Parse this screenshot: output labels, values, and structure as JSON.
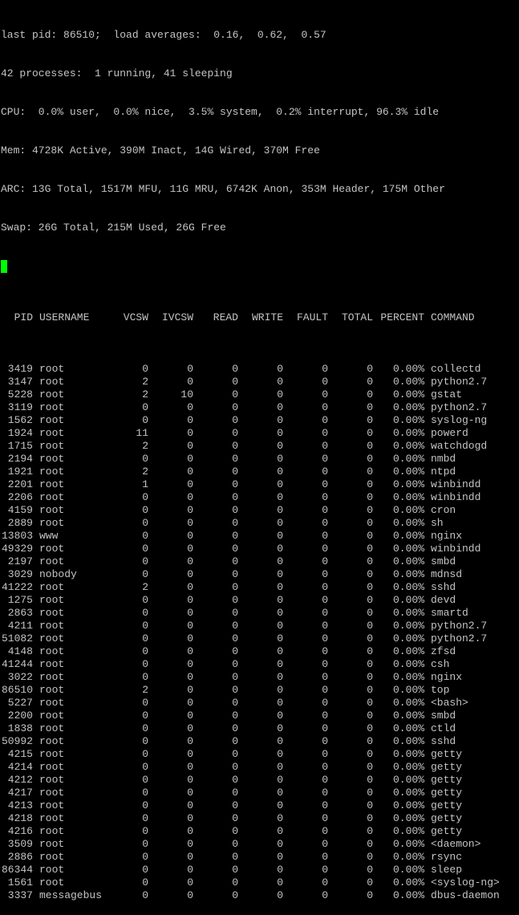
{
  "colors": {
    "background": "#000000",
    "text": "#c4c4c4",
    "cursor": "#00ff00"
  },
  "header": {
    "line1": "last pid: 86510;  load averages:  0.16,  0.62,  0.57",
    "line2": "42 processes:  1 running, 41 sleeping",
    "line3": "CPU:  0.0% user,  0.0% nice,  3.5% system,  0.2% interrupt, 96.3% idle",
    "line4": "Mem: 4728K Active, 390M Inact, 14G Wired, 370M Free",
    "line5": "ARC: 13G Total, 1517M MFU, 11G MRU, 6742K Anon, 353M Header, 175M Other",
    "line6": "Swap: 26G Total, 215M Used, 26G Free"
  },
  "table": {
    "columns": {
      "pid": "PID",
      "username": "USERNAME",
      "vcsw": "VCSW",
      "ivcsw": "IVCSW",
      "read": "READ",
      "write": "WRITE",
      "fault": "FAULT",
      "total": "TOTAL",
      "percent": "PERCENT",
      "command": "COMMAND"
    },
    "rows": [
      {
        "pid": "3419",
        "user": "root",
        "vcsw": "0",
        "ivcsw": "0",
        "read": "0",
        "write": "0",
        "fault": "0",
        "total": "0",
        "percent": "0.00%",
        "command": "collectd"
      },
      {
        "pid": "3147",
        "user": "root",
        "vcsw": "2",
        "ivcsw": "0",
        "read": "0",
        "write": "0",
        "fault": "0",
        "total": "0",
        "percent": "0.00%",
        "command": "python2.7"
      },
      {
        "pid": "5228",
        "user": "root",
        "vcsw": "2",
        "ivcsw": "10",
        "read": "0",
        "write": "0",
        "fault": "0",
        "total": "0",
        "percent": "0.00%",
        "command": "gstat"
      },
      {
        "pid": "3119",
        "user": "root",
        "vcsw": "0",
        "ivcsw": "0",
        "read": "0",
        "write": "0",
        "fault": "0",
        "total": "0",
        "percent": "0.00%",
        "command": "python2.7"
      },
      {
        "pid": "1562",
        "user": "root",
        "vcsw": "0",
        "ivcsw": "0",
        "read": "0",
        "write": "0",
        "fault": "0",
        "total": "0",
        "percent": "0.00%",
        "command": "syslog-ng"
      },
      {
        "pid": "1924",
        "user": "root",
        "vcsw": "11",
        "ivcsw": "0",
        "read": "0",
        "write": "0",
        "fault": "0",
        "total": "0",
        "percent": "0.00%",
        "command": "powerd"
      },
      {
        "pid": "1715",
        "user": "root",
        "vcsw": "2",
        "ivcsw": "0",
        "read": "0",
        "write": "0",
        "fault": "0",
        "total": "0",
        "percent": "0.00%",
        "command": "watchdogd"
      },
      {
        "pid": "2194",
        "user": "root",
        "vcsw": "0",
        "ivcsw": "0",
        "read": "0",
        "write": "0",
        "fault": "0",
        "total": "0",
        "percent": "0.00%",
        "command": "nmbd"
      },
      {
        "pid": "1921",
        "user": "root",
        "vcsw": "2",
        "ivcsw": "0",
        "read": "0",
        "write": "0",
        "fault": "0",
        "total": "0",
        "percent": "0.00%",
        "command": "ntpd"
      },
      {
        "pid": "2201",
        "user": "root",
        "vcsw": "1",
        "ivcsw": "0",
        "read": "0",
        "write": "0",
        "fault": "0",
        "total": "0",
        "percent": "0.00%",
        "command": "winbindd"
      },
      {
        "pid": "2206",
        "user": "root",
        "vcsw": "0",
        "ivcsw": "0",
        "read": "0",
        "write": "0",
        "fault": "0",
        "total": "0",
        "percent": "0.00%",
        "command": "winbindd"
      },
      {
        "pid": "4159",
        "user": "root",
        "vcsw": "0",
        "ivcsw": "0",
        "read": "0",
        "write": "0",
        "fault": "0",
        "total": "0",
        "percent": "0.00%",
        "command": "cron"
      },
      {
        "pid": "2889",
        "user": "root",
        "vcsw": "0",
        "ivcsw": "0",
        "read": "0",
        "write": "0",
        "fault": "0",
        "total": "0",
        "percent": "0.00%",
        "command": "sh"
      },
      {
        "pid": "13803",
        "user": "www",
        "vcsw": "0",
        "ivcsw": "0",
        "read": "0",
        "write": "0",
        "fault": "0",
        "total": "0",
        "percent": "0.00%",
        "command": "nginx"
      },
      {
        "pid": "49329",
        "user": "root",
        "vcsw": "0",
        "ivcsw": "0",
        "read": "0",
        "write": "0",
        "fault": "0",
        "total": "0",
        "percent": "0.00%",
        "command": "winbindd"
      },
      {
        "pid": "2197",
        "user": "root",
        "vcsw": "0",
        "ivcsw": "0",
        "read": "0",
        "write": "0",
        "fault": "0",
        "total": "0",
        "percent": "0.00%",
        "command": "smbd"
      },
      {
        "pid": "3029",
        "user": "nobody",
        "vcsw": "0",
        "ivcsw": "0",
        "read": "0",
        "write": "0",
        "fault": "0",
        "total": "0",
        "percent": "0.00%",
        "command": "mdnsd"
      },
      {
        "pid": "41222",
        "user": "root",
        "vcsw": "2",
        "ivcsw": "0",
        "read": "0",
        "write": "0",
        "fault": "0",
        "total": "0",
        "percent": "0.00%",
        "command": "sshd"
      },
      {
        "pid": "1275",
        "user": "root",
        "vcsw": "0",
        "ivcsw": "0",
        "read": "0",
        "write": "0",
        "fault": "0",
        "total": "0",
        "percent": "0.00%",
        "command": "devd"
      },
      {
        "pid": "2863",
        "user": "root",
        "vcsw": "0",
        "ivcsw": "0",
        "read": "0",
        "write": "0",
        "fault": "0",
        "total": "0",
        "percent": "0.00%",
        "command": "smartd"
      },
      {
        "pid": "4211",
        "user": "root",
        "vcsw": "0",
        "ivcsw": "0",
        "read": "0",
        "write": "0",
        "fault": "0",
        "total": "0",
        "percent": "0.00%",
        "command": "python2.7"
      },
      {
        "pid": "51082",
        "user": "root",
        "vcsw": "0",
        "ivcsw": "0",
        "read": "0",
        "write": "0",
        "fault": "0",
        "total": "0",
        "percent": "0.00%",
        "command": "python2.7"
      },
      {
        "pid": "4148",
        "user": "root",
        "vcsw": "0",
        "ivcsw": "0",
        "read": "0",
        "write": "0",
        "fault": "0",
        "total": "0",
        "percent": "0.00%",
        "command": "zfsd"
      },
      {
        "pid": "41244",
        "user": "root",
        "vcsw": "0",
        "ivcsw": "0",
        "read": "0",
        "write": "0",
        "fault": "0",
        "total": "0",
        "percent": "0.00%",
        "command": "csh"
      },
      {
        "pid": "3022",
        "user": "root",
        "vcsw": "0",
        "ivcsw": "0",
        "read": "0",
        "write": "0",
        "fault": "0",
        "total": "0",
        "percent": "0.00%",
        "command": "nginx"
      },
      {
        "pid": "86510",
        "user": "root",
        "vcsw": "2",
        "ivcsw": "0",
        "read": "0",
        "write": "0",
        "fault": "0",
        "total": "0",
        "percent": "0.00%",
        "command": "top"
      },
      {
        "pid": "5227",
        "user": "root",
        "vcsw": "0",
        "ivcsw": "0",
        "read": "0",
        "write": "0",
        "fault": "0",
        "total": "0",
        "percent": "0.00%",
        "command": "<bash>"
      },
      {
        "pid": "2200",
        "user": "root",
        "vcsw": "0",
        "ivcsw": "0",
        "read": "0",
        "write": "0",
        "fault": "0",
        "total": "0",
        "percent": "0.00%",
        "command": "smbd"
      },
      {
        "pid": "1838",
        "user": "root",
        "vcsw": "0",
        "ivcsw": "0",
        "read": "0",
        "write": "0",
        "fault": "0",
        "total": "0",
        "percent": "0.00%",
        "command": "ctld"
      },
      {
        "pid": "50992",
        "user": "root",
        "vcsw": "0",
        "ivcsw": "0",
        "read": "0",
        "write": "0",
        "fault": "0",
        "total": "0",
        "percent": "0.00%",
        "command": "sshd"
      },
      {
        "pid": "4215",
        "user": "root",
        "vcsw": "0",
        "ivcsw": "0",
        "read": "0",
        "write": "0",
        "fault": "0",
        "total": "0",
        "percent": "0.00%",
        "command": "getty"
      },
      {
        "pid": "4214",
        "user": "root",
        "vcsw": "0",
        "ivcsw": "0",
        "read": "0",
        "write": "0",
        "fault": "0",
        "total": "0",
        "percent": "0.00%",
        "command": "getty"
      },
      {
        "pid": "4212",
        "user": "root",
        "vcsw": "0",
        "ivcsw": "0",
        "read": "0",
        "write": "0",
        "fault": "0",
        "total": "0",
        "percent": "0.00%",
        "command": "getty"
      },
      {
        "pid": "4217",
        "user": "root",
        "vcsw": "0",
        "ivcsw": "0",
        "read": "0",
        "write": "0",
        "fault": "0",
        "total": "0",
        "percent": "0.00%",
        "command": "getty"
      },
      {
        "pid": "4213",
        "user": "root",
        "vcsw": "0",
        "ivcsw": "0",
        "read": "0",
        "write": "0",
        "fault": "0",
        "total": "0",
        "percent": "0.00%",
        "command": "getty"
      },
      {
        "pid": "4218",
        "user": "root",
        "vcsw": "0",
        "ivcsw": "0",
        "read": "0",
        "write": "0",
        "fault": "0",
        "total": "0",
        "percent": "0.00%",
        "command": "getty"
      },
      {
        "pid": "4216",
        "user": "root",
        "vcsw": "0",
        "ivcsw": "0",
        "read": "0",
        "write": "0",
        "fault": "0",
        "total": "0",
        "percent": "0.00%",
        "command": "getty"
      },
      {
        "pid": "3509",
        "user": "root",
        "vcsw": "0",
        "ivcsw": "0",
        "read": "0",
        "write": "0",
        "fault": "0",
        "total": "0",
        "percent": "0.00%",
        "command": "<daemon>"
      },
      {
        "pid": "2886",
        "user": "root",
        "vcsw": "0",
        "ivcsw": "0",
        "read": "0",
        "write": "0",
        "fault": "0",
        "total": "0",
        "percent": "0.00%",
        "command": "rsync"
      },
      {
        "pid": "86344",
        "user": "root",
        "vcsw": "0",
        "ivcsw": "0",
        "read": "0",
        "write": "0",
        "fault": "0",
        "total": "0",
        "percent": "0.00%",
        "command": "sleep"
      },
      {
        "pid": "1561",
        "user": "root",
        "vcsw": "0",
        "ivcsw": "0",
        "read": "0",
        "write": "0",
        "fault": "0",
        "total": "0",
        "percent": "0.00%",
        "command": "<syslog-ng>"
      },
      {
        "pid": "3337",
        "user": "messagebus",
        "vcsw": "0",
        "ivcsw": "0",
        "read": "0",
        "write": "0",
        "fault": "0",
        "total": "0",
        "percent": "0.00%",
        "command": "dbus-daemon"
      }
    ]
  }
}
